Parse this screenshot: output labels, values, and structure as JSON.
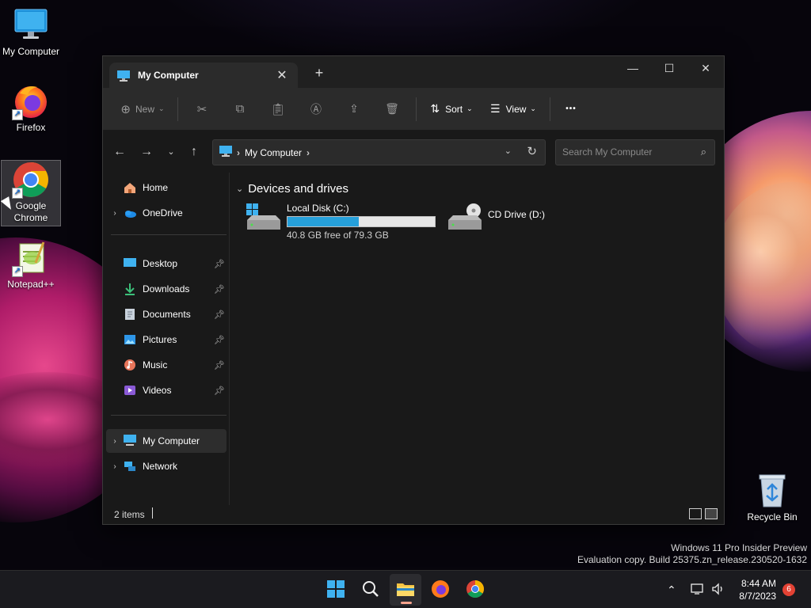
{
  "desktop": {
    "icons": [
      {
        "name": "My Computer"
      },
      {
        "name": "Firefox"
      },
      {
        "name": "Google Chrome"
      },
      {
        "name": "Notepad++"
      },
      {
        "name": "Recycle Bin"
      }
    ],
    "watermark": {
      "line1": "Windows 11 Pro Insider Preview",
      "line2": "Evaluation copy. Build 25375.zn_release.230520-1632"
    }
  },
  "explorer": {
    "tab_title": "My Computer",
    "tab_close": "✕",
    "new_tab": "+",
    "window_controls": {
      "minimize": "—",
      "maximize": "☐",
      "close": "✕"
    },
    "toolbar": {
      "new_label": "New",
      "sort_label": "Sort",
      "view_label": "View",
      "more_label": "•••"
    },
    "address": {
      "segments": [
        "My Computer"
      ],
      "separator": "›"
    },
    "search": {
      "placeholder": "Search My Computer"
    },
    "nav": {
      "home": "Home",
      "onedrive": "OneDrive",
      "quick": [
        {
          "label": "Desktop"
        },
        {
          "label": "Downloads"
        },
        {
          "label": "Documents"
        },
        {
          "label": "Pictures"
        },
        {
          "label": "Music"
        },
        {
          "label": "Videos"
        }
      ],
      "my_computer": "My Computer",
      "network": "Network"
    },
    "content": {
      "group_title": "Devices and drives",
      "drives": [
        {
          "name": "Local Disk (C:)",
          "info": "40.8 GB free of 79.3 GB",
          "used_fraction": 0.486
        },
        {
          "name": "CD Drive (D:)"
        }
      ]
    },
    "status": {
      "items": "2 items"
    }
  },
  "taskbar": {
    "time": "8:44 AM",
    "date": "8/7/2023",
    "notifications": "6"
  },
  "colors": {
    "accent": "#26a0da",
    "window_bg": "#191919",
    "toolbar_bg": "#2b2b2b",
    "notification_badge": "#e34234"
  }
}
